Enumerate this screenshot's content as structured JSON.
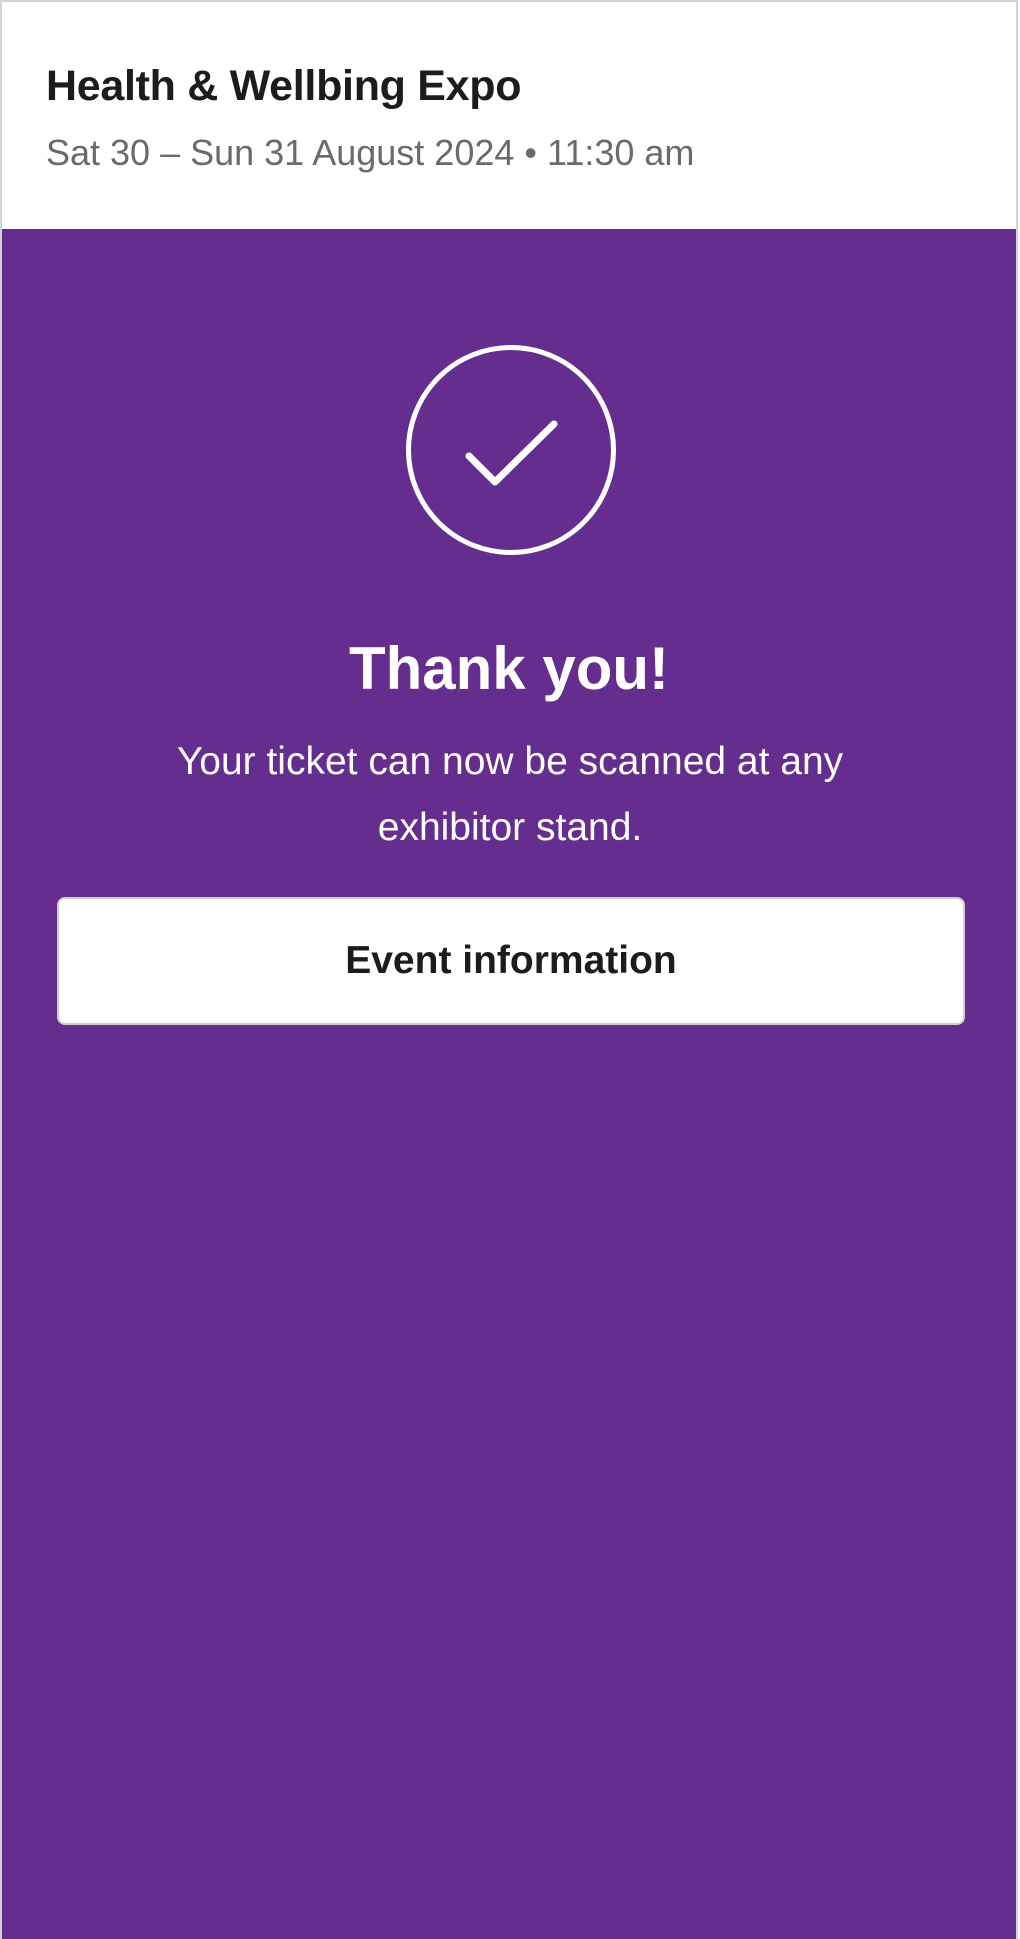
{
  "event": {
    "title": "Health & Wellbing Expo",
    "date_time": "Sat 30 – Sun 31 August 2024 • 11:30 am"
  },
  "confirmation": {
    "icon": "checkmark-circle-icon",
    "title": "Thank you!",
    "message": "Your ticket can now be scanned at any exhibitor stand."
  },
  "actions": {
    "event_info_label": "Event information"
  },
  "colors": {
    "background": "#652d8e",
    "header_background": "#ffffff",
    "primary_text": "#1c1c1c",
    "secondary_text": "#6a6a6a"
  }
}
